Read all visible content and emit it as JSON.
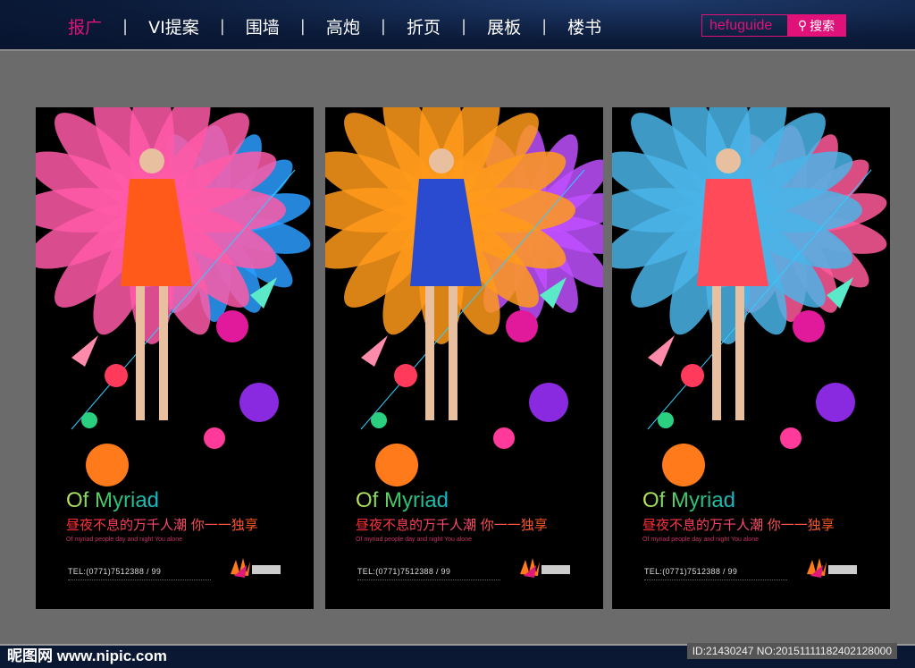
{
  "nav": {
    "items": [
      "报广",
      "VI提案",
      "围墙",
      "高炮",
      "折页",
      "展板",
      "楼书"
    ],
    "active": 0
  },
  "search": {
    "value": "hefuguide",
    "button": "搜索"
  },
  "posters": [
    {
      "title": "Of Myriad",
      "cn": "昼夜不息的万千人潮  你一一独享",
      "en": "Of myriad people day and night You alone",
      "tel": "TEL:(0771)7512388 / 99",
      "dress": "#ff5a1a",
      "flower1": "#ff5aa8",
      "flower2": "#2a9cff"
    },
    {
      "title": "Of Myriad",
      "cn": "昼夜不息的万千人潮  你一一独享",
      "en": "Of myriad people day and night You alone",
      "tel": "TEL:(0771)7512388 / 99",
      "dress": "#2a4ad0",
      "flower1": "#ff9a1a",
      "flower2": "#c050ff"
    },
    {
      "title": "Of Myriad",
      "cn": "昼夜不息的万千人潮  你一一独享",
      "en": "Of myriad people day and night You alone",
      "tel": "TEL:(0771)7512388 / 99",
      "dress": "#ff4a5a",
      "flower1": "#4ab4e8",
      "flower2": "#ff5a9a"
    }
  ],
  "footer": {
    "site": "昵图网 www.nipic.com",
    "id": "ID:21430247 NO:20151111182402128000"
  }
}
